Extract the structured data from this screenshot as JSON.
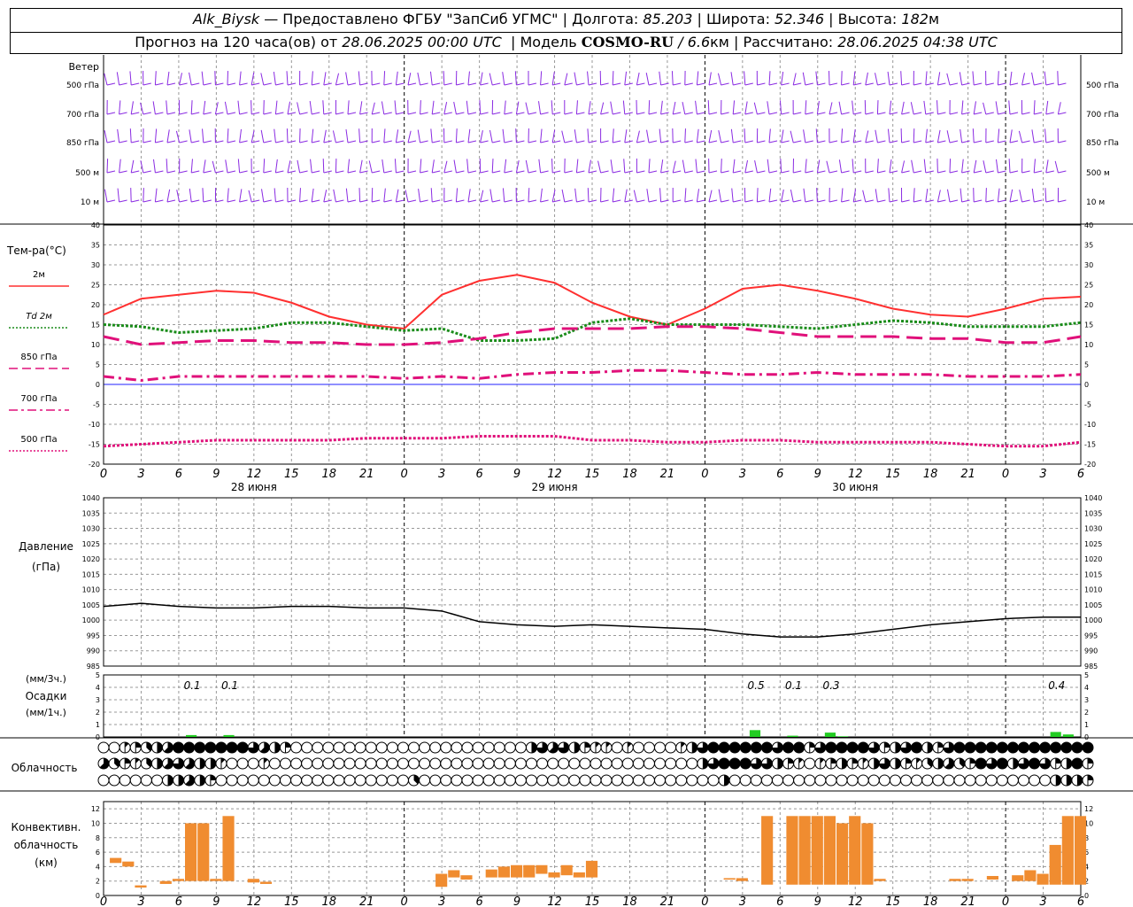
{
  "header": {
    "station": "Alk_Biysk",
    "dash": "—",
    "provider": "Предоставлено ФГБУ \"ЗапСиб УГМС\"",
    "sep": "|",
    "lon_label": "Долгота:",
    "lon_value": "85.203",
    "lat_label": "Широта:",
    "lat_value": "52.346",
    "alt_label": "Высота:",
    "alt_value": "182",
    "alt_unit": "м",
    "forecast_prefix": "Прогноз на 120 часа(ов) от",
    "forecast_start": "28.06.2025 00:00 UTC",
    "model_label": "Модель",
    "model_name": "COSMO-RU",
    "model_slash": "/",
    "model_res": "6.6",
    "model_res_unit": "км",
    "calc_label": "Рассчитано:",
    "calc_time": "28.06.2025 04:38 UTC"
  },
  "colors": {
    "wind": "#8a2be2",
    "temp2m": "#ff3030",
    "td2m": "#1a8c1a",
    "t850": "#e0107a",
    "t700": "#e0107a",
    "t500": "#e0107a",
    "zero_line": "#2020ff",
    "pressure": "#000000",
    "precip": "#22cc22",
    "convective": "#f08c30",
    "grid": "#999999"
  },
  "time_axis": {
    "hour_labels": [
      "0",
      "3",
      "6",
      "9",
      "12",
      "15",
      "18",
      "21",
      "0",
      "3",
      "6",
      "9",
      "12",
      "15",
      "18",
      "21",
      "0",
      "3",
      "6",
      "9",
      "12",
      "15",
      "18",
      "21",
      "0",
      "3",
      "6"
    ],
    "day_labels": [
      "28 июня",
      "29 июня",
      "30 июня"
    ]
  },
  "chart_data": [
    {
      "type": "wind-barbs",
      "panel_label": "Ветер",
      "levels": [
        "500 гПа",
        "700 гПа",
        "850 гПа",
        "500 м",
        "10 м"
      ]
    },
    {
      "type": "line",
      "panel_label": "Тем-ра(°C)",
      "x_hours": [
        0,
        3,
        6,
        9,
        12,
        15,
        18,
        21,
        24,
        27,
        30,
        33,
        36,
        39,
        42,
        45,
        48,
        51,
        54,
        57,
        60,
        63,
        66,
        69,
        72,
        75,
        78
      ],
      "ylim": [
        -20,
        40
      ],
      "yticks": [
        "40",
        "35",
        "30",
        "25",
        "20",
        "15",
        "10",
        "5",
        "0",
        "-5",
        "-10",
        "-15",
        "-20"
      ],
      "series": [
        {
          "name": "2м",
          "style": "solid",
          "values": [
            17.5,
            21.5,
            22.5,
            23.5,
            23,
            20.5,
            17,
            15,
            14,
            22.5,
            26,
            27.5,
            25.5,
            20.5,
            17,
            15,
            19,
            24,
            25,
            23.5,
            21.5,
            19,
            17.5,
            17,
            19,
            21.5,
            22
          ]
        },
        {
          "name": "Td 2м",
          "style": "dotted",
          "values": [
            15,
            14.5,
            13,
            13.5,
            14,
            15.5,
            15.5,
            14.5,
            13.5,
            14,
            11,
            11,
            11.5,
            15.5,
            16.5,
            15,
            15,
            15,
            14.5,
            14,
            15,
            16,
            15.5,
            14.5,
            14.5,
            14.5,
            15.5
          ]
        },
        {
          "name": "850 гПа",
          "style": "long-dash",
          "values": [
            12,
            10,
            10.5,
            11,
            11,
            10.5,
            10.5,
            10,
            10,
            10.5,
            11.5,
            13,
            14,
            14,
            14,
            14.5,
            14.5,
            14,
            13,
            12,
            12,
            12,
            11.5,
            11.5,
            10.5,
            10.5,
            12
          ]
        },
        {
          "name": "700 гПа",
          "style": "dash-dot",
          "values": [
            2,
            1,
            2,
            2,
            2,
            2,
            2,
            2,
            1.5,
            2,
            1.5,
            2.5,
            3,
            3,
            3.5,
            3.5,
            3,
            2.5,
            2.5,
            3,
            2.5,
            2.5,
            2.5,
            2,
            2,
            2,
            2.5
          ]
        },
        {
          "name": "500 гПа",
          "style": "dotted",
          "values": [
            -15.5,
            -15,
            -14.5,
            -14,
            -14,
            -14,
            -14,
            -13.5,
            -13.5,
            -13.5,
            -13,
            -13,
            -13,
            -14,
            -14,
            -14.5,
            -14.5,
            -14,
            -14,
            -14.5,
            -14.5,
            -14.5,
            -14.5,
            -15,
            -15.5,
            -15.5,
            -14.5
          ]
        }
      ]
    },
    {
      "type": "line",
      "panel_label": "Давление",
      "unit_label": "(гПа)",
      "ylim": [
        985,
        1040
      ],
      "yticks": [
        "1040",
        "1035",
        "1030",
        "1025",
        "1020",
        "1015",
        "1010",
        "1005",
        "1000",
        "995",
        "990",
        "985"
      ],
      "x_hours": [
        0,
        3,
        6,
        9,
        12,
        15,
        18,
        21,
        24,
        27,
        30,
        33,
        36,
        39,
        42,
        45,
        48,
        51,
        54,
        57,
        60,
        63,
        66,
        69,
        72,
        75,
        78
      ],
      "series": [
        {
          "name": "Давление",
          "values": [
            1004.5,
            1005.5,
            1004.5,
            1004,
            1004,
            1004.5,
            1004.5,
            1004,
            1004,
            1003,
            999.5,
            998.5,
            998,
            998.5,
            998,
            997.5,
            997,
            995.5,
            994.5,
            994.5,
            995.5,
            997,
            998.5,
            999.5,
            1000.5,
            1001,
            1001
          ]
        }
      ]
    },
    {
      "type": "bar",
      "panel_label": "Осадки",
      "unit_3h": "(мм/3ч.)",
      "unit_1h": "(мм/1ч.)",
      "ylim": [
        0,
        5
      ],
      "yticks": [
        "5",
        "4",
        "3",
        "2",
        "1",
        "0"
      ],
      "totals_3h": [
        {
          "hour": 7.5,
          "label": "0.1"
        },
        {
          "hour": 10.5,
          "label": "0.1"
        },
        {
          "hour": 52.5,
          "label": "0.5"
        },
        {
          "hour": 55.5,
          "label": "0.1"
        },
        {
          "hour": 58.5,
          "label": "0.3"
        },
        {
          "hour": 76.5,
          "label": "0.4"
        }
      ],
      "hourly": [
        {
          "hour": 7,
          "value": 0.15
        },
        {
          "hour": 10,
          "value": 0.15
        },
        {
          "hour": 52,
          "value": 0.55
        },
        {
          "hour": 55,
          "value": 0.1
        },
        {
          "hour": 58,
          "value": 0.35
        },
        {
          "hour": 59,
          "value": 0.05
        },
        {
          "hour": 76,
          "value": 0.4
        },
        {
          "hour": 77,
          "value": 0.2
        }
      ]
    },
    {
      "type": "cloud-symbols",
      "panel_label": "Облачность",
      "rows": [
        [
          0,
          0,
          1,
          2,
          3,
          4,
          5,
          8,
          8,
          8,
          8,
          8,
          8,
          8,
          6,
          5,
          4,
          2,
          0,
          0,
          0,
          0,
          0,
          0,
          0,
          0,
          0,
          0,
          0,
          0,
          0,
          0,
          0,
          0,
          0,
          0,
          0,
          0,
          0,
          0,
          4,
          6,
          5,
          6,
          4,
          2,
          1,
          1,
          0,
          1,
          0,
          0,
          0,
          0,
          1,
          4,
          6,
          8,
          8,
          8,
          8,
          8,
          8,
          6,
          8,
          8,
          2,
          6,
          8,
          8,
          8,
          8,
          6,
          2,
          4,
          6,
          8,
          4,
          2,
          6,
          8,
          8,
          8,
          8,
          8,
          8,
          8,
          8,
          8,
          8,
          8,
          8,
          8
        ],
        [
          5,
          3,
          2,
          1,
          3,
          4,
          5,
          6,
          5,
          4,
          4,
          1,
          0,
          0,
          0,
          1,
          0,
          0,
          0,
          0,
          0,
          0,
          0,
          0,
          0,
          0,
          0,
          0,
          0,
          0,
          0,
          0,
          0,
          0,
          0,
          0,
          0,
          0,
          0,
          0,
          0,
          0,
          0,
          0,
          0,
          0,
          0,
          0,
          0,
          0,
          0,
          0,
          0,
          0,
          0,
          0,
          4,
          6,
          8,
          8,
          8,
          6,
          6,
          4,
          2,
          1,
          0,
          1,
          2,
          4,
          2,
          1,
          4,
          6,
          4,
          2,
          1,
          3,
          4,
          5,
          3,
          2,
          8,
          6,
          8,
          4,
          6,
          8,
          6,
          2,
          4,
          8,
          2
        ],
        [
          0,
          0,
          0,
          0,
          0,
          0,
          4,
          4,
          5,
          4,
          2,
          0,
          0,
          0,
          0,
          0,
          0,
          0,
          0,
          0,
          0,
          0,
          0,
          0,
          0,
          0,
          0,
          0,
          0,
          3,
          0,
          0,
          0,
          0,
          0,
          0,
          0,
          0,
          0,
          0,
          0,
          0,
          0,
          0,
          0,
          0,
          0,
          0,
          0,
          0,
          0,
          0,
          0,
          0,
          0,
          0,
          0,
          0,
          4,
          0,
          0,
          0,
          0,
          0,
          0,
          0,
          0,
          0,
          0,
          0,
          0,
          0,
          0,
          0,
          0,
          0,
          0,
          0,
          0,
          0,
          0,
          0,
          0,
          0,
          0,
          0,
          0,
          0,
          0,
          4,
          4,
          4,
          2
        ]
      ]
    },
    {
      "type": "floating-bar",
      "panel_label_1": "Конвективн.",
      "panel_label_2": "облачность",
      "panel_label_3": "(км)",
      "ylim": [
        0,
        13
      ],
      "yticks": [
        "12",
        "10",
        "8",
        "6",
        "4",
        "2",
        "0"
      ],
      "bars": [
        {
          "hour": 1,
          "bottom": 4.5,
          "top": 5.2
        },
        {
          "hour": 2,
          "bottom": 4,
          "top": 4.7
        },
        {
          "hour": 3,
          "bottom": 1.1,
          "top": 1.4
        },
        {
          "hour": 5,
          "bottom": 1.6,
          "top": 2
        },
        {
          "hour": 6,
          "bottom": 2,
          "top": 2.3
        },
        {
          "hour": 7,
          "bottom": 2,
          "top": 10
        },
        {
          "hour": 8,
          "bottom": 2,
          "top": 10
        },
        {
          "hour": 9,
          "bottom": 2,
          "top": 2.3
        },
        {
          "hour": 10,
          "bottom": 2,
          "top": 11
        },
        {
          "hour": 12,
          "bottom": 1.8,
          "top": 2.3
        },
        {
          "hour": 13,
          "bottom": 1.6,
          "top": 1.9
        },
        {
          "hour": 27,
          "bottom": 1.2,
          "top": 3
        },
        {
          "hour": 28,
          "bottom": 2.5,
          "top": 3.5
        },
        {
          "hour": 29,
          "bottom": 2.2,
          "top": 2.8
        },
        {
          "hour": 31,
          "bottom": 2.5,
          "top": 3.6
        },
        {
          "hour": 32,
          "bottom": 2.5,
          "top": 4
        },
        {
          "hour": 33,
          "bottom": 2.5,
          "top": 4.2
        },
        {
          "hour": 34,
          "bottom": 2.5,
          "top": 4.2
        },
        {
          "hour": 35,
          "bottom": 3,
          "top": 4.2
        },
        {
          "hour": 36,
          "bottom": 2.5,
          "top": 3.2
        },
        {
          "hour": 37,
          "bottom": 2.8,
          "top": 4.2
        },
        {
          "hour": 38,
          "bottom": 2.5,
          "top": 3.2
        },
        {
          "hour": 39,
          "bottom": 2.5,
          "top": 4.8
        },
        {
          "hour": 50,
          "bottom": 2.2,
          "top": 2.4
        },
        {
          "hour": 51,
          "bottom": 2,
          "top": 2.4
        },
        {
          "hour": 53,
          "bottom": 1.5,
          "top": 11
        },
        {
          "hour": 55,
          "bottom": 1.5,
          "top": 11
        },
        {
          "hour": 56,
          "bottom": 1.5,
          "top": 11
        },
        {
          "hour": 57,
          "bottom": 1.5,
          "top": 11
        },
        {
          "hour": 58,
          "bottom": 1.5,
          "top": 11
        },
        {
          "hour": 59,
          "bottom": 1.5,
          "top": 10
        },
        {
          "hour": 60,
          "bottom": 1.5,
          "top": 11
        },
        {
          "hour": 61,
          "bottom": 1.5,
          "top": 10
        },
        {
          "hour": 62,
          "bottom": 2,
          "top": 2.3
        },
        {
          "hour": 68,
          "bottom": 2,
          "top": 2.3
        },
        {
          "hour": 69,
          "bottom": 2,
          "top": 2.3
        },
        {
          "hour": 71,
          "bottom": 2.2,
          "top": 2.7
        },
        {
          "hour": 73,
          "bottom": 2,
          "top": 2.8
        },
        {
          "hour": 74,
          "bottom": 2,
          "top": 3.5
        },
        {
          "hour": 75,
          "bottom": 1.5,
          "top": 3
        },
        {
          "hour": 76,
          "bottom": 1.5,
          "top": 7
        },
        {
          "hour": 77,
          "bottom": 1.5,
          "top": 11
        },
        {
          "hour": 78,
          "bottom": 1.5,
          "top": 11
        }
      ]
    }
  ]
}
